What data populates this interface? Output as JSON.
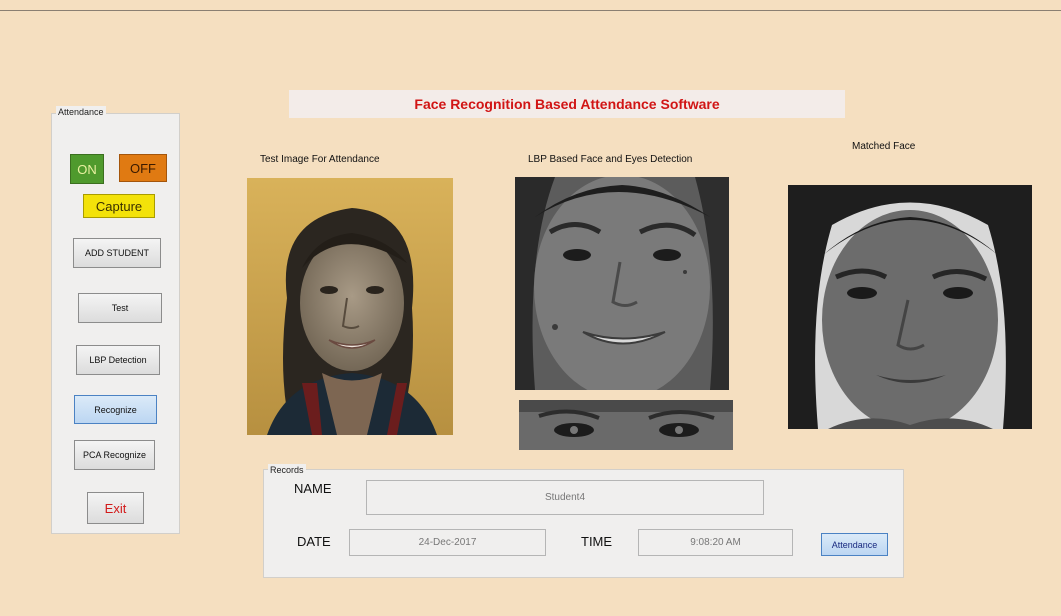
{
  "title": "Face Recognition Based Attendance Software",
  "attendance_panel": {
    "title": "Attendance",
    "buttons": {
      "on": "ON",
      "off": "OFF",
      "capture": "Capture",
      "add_student": "ADD STUDENT",
      "test": "Test",
      "lbp_detection": "LBP Detection",
      "recognize": "Recognize",
      "pca_recognize": "PCA Recognize",
      "exit": "Exit"
    }
  },
  "captions": {
    "test_image": "Test Image For Attendance",
    "lbp_detection": "LBP Based Face and Eyes Detection",
    "matched_face": "Matched Face"
  },
  "records": {
    "title": "Records",
    "name_label": "NAME",
    "name_value": "Student4",
    "date_label": "DATE",
    "date_value": "24-Dec-2017",
    "time_label": "TIME",
    "time_value": "9:08:20 AM",
    "attendance_button": "Attendance"
  },
  "colors": {
    "background": "#f5dfc0",
    "title_text": "#d11515",
    "on_button": "#4f9a2d",
    "off_button": "#e07a12",
    "capture_button": "#f3e20a"
  }
}
